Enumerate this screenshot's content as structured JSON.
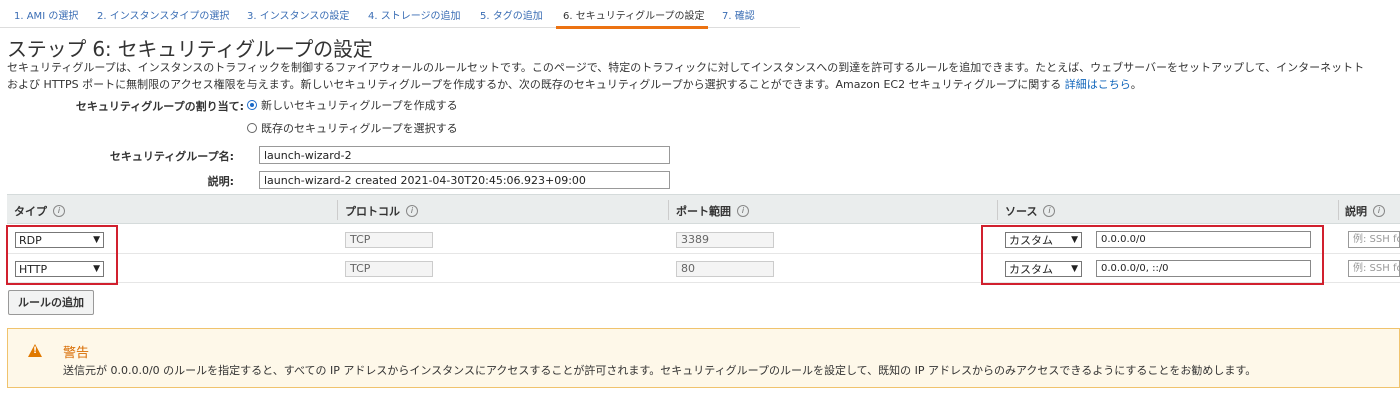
{
  "steps": [
    {
      "label": "1. AMI の選択",
      "active": false
    },
    {
      "label": "2. インスタンスタイプの選択",
      "active": false
    },
    {
      "label": "3. インスタンスの設定",
      "active": false
    },
    {
      "label": "4. ストレージの追加",
      "active": false
    },
    {
      "label": "5. タグの追加",
      "active": false
    },
    {
      "label": "6. セキュリティグループの設定",
      "active": true
    },
    {
      "label": "7. 確認",
      "active": false
    }
  ],
  "title": "ステップ 6: セキュリティグループの設定",
  "description": {
    "line1": "セキュリティグループは、インスタンスのトラフィックを制御するファイアウォールのルールセットです。このページで、特定のトラフィックに対してインスタンスへの到達を許可するルールを追加できます。たとえば、ウェブサーバーをセットアップして、インターネットト",
    "line2": "および HTTPS ポートに無制限のアクセス権限を与えます。新しいセキュリティグループを作成するか、次の既存のセキュリティグループから選択することができます。Amazon EC2 セキュリティグループに関する ",
    "link": "詳細はこちら",
    "suffix": "。"
  },
  "assign": {
    "label": "セキュリティグループの割り当て:",
    "option_new": "新しいセキュリティグループを作成する",
    "option_existing": "既存のセキュリティグループを選択する",
    "selected": "new"
  },
  "group_name": {
    "label": "セキュリティグループ名:",
    "value": "launch-wizard-2"
  },
  "group_desc": {
    "label": "説明:",
    "value": "launch-wizard-2 created 2021-04-30T20:45:06.923+09:00"
  },
  "table": {
    "headers": {
      "type": "タイプ",
      "protocol": "プロトコル",
      "port": "ポート範囲",
      "source": "ソース",
      "description": "説明"
    },
    "info_icon": "i",
    "rows": [
      {
        "type": "RDP",
        "protocol": "TCP",
        "port": "3389",
        "source_mode": "カスタム",
        "source": "0.0.0.0/0",
        "description_placeholder": "例: SSH fo"
      },
      {
        "type": "HTTP",
        "protocol": "TCP",
        "port": "80",
        "source_mode": "カスタム",
        "source": "0.0.0.0/0, ::/0",
        "description_placeholder": "例: SSH fo"
      }
    ]
  },
  "add_rule_button": "ルールの追加",
  "warning": {
    "icon": "warning-icon",
    "title": "警告",
    "text": "送信元が 0.0.0.0/0 のルールを指定すると、すべての IP アドレスからインスタンスにアクセスすることが許可されます。セキュリティグループのルールを設定して、既知の IP アドレスからのみアクセスできるようにすることをお勧めします。"
  },
  "colors": {
    "link": "#1166bb",
    "active_tab": "#ec7211",
    "highlight_box": "#d1202e",
    "warning_title": "#d86b00"
  }
}
